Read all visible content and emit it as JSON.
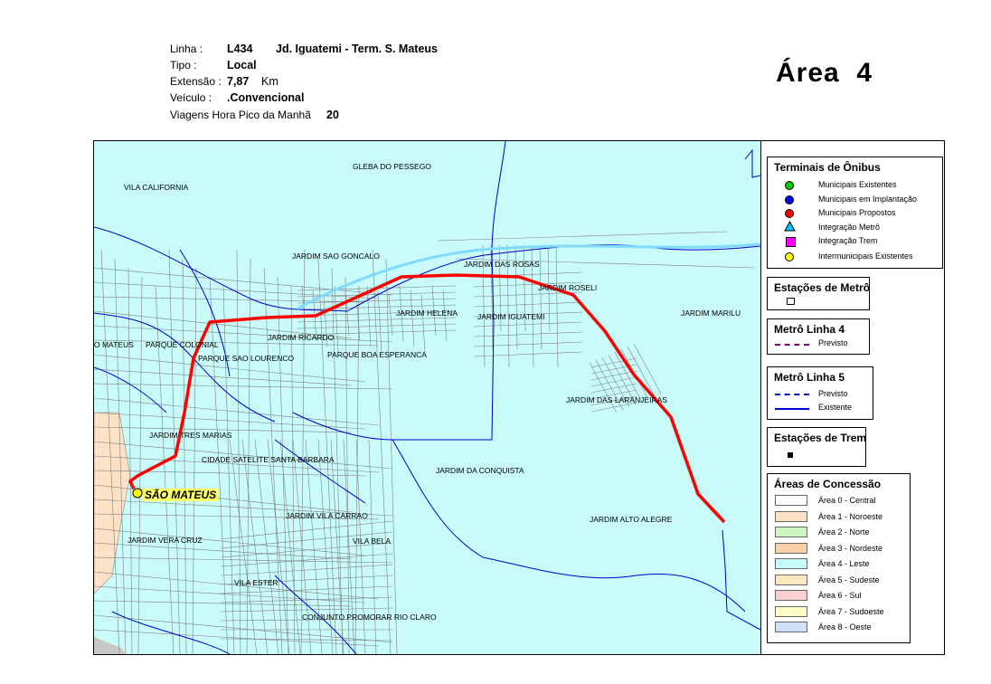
{
  "header": {
    "linha_label": "Linha :",
    "linha_code": "L434",
    "linha_name": "Jd. Iguatemi - Term. S. Mateus",
    "tipo_label": "Tipo :",
    "tipo_value": "Local",
    "extensao_label": "Extensão :",
    "extensao_value": "7,87",
    "extensao_unit": "Km",
    "veiculo_label": "Veículo :",
    "veiculo_value": ".Convencional",
    "viagens_label": "Viagens Hora Pico da Manhã",
    "viagens_value": "20",
    "area_title": "Área  4"
  },
  "map": {
    "colors": {
      "background": "#c9fbfb",
      "route": "#ff0000",
      "streets": "#7f7f7f",
      "rivers": "#0000c8",
      "area1_zone": "#fde2c5"
    },
    "terminal_label": "SÃO MATEUS",
    "places": [
      "GLEBA DO PESSEGO",
      "VILA CALIFORNIA",
      "JARDIM SAO GONCALO",
      "JARDIM DAS ROSAS",
      "JARDIM ROSELI",
      "JARDIM HELENA",
      "JARDIM IGUATEMI",
      "JARDIM MARILU",
      "O MATEUS",
      "PARQUE COLONIAL",
      "JARDIM RICARDO",
      "PARQUE SAO LOURENCO",
      "PARQUE BOA ESPERANCA",
      "JARDIM DAS LARANJEIRAS",
      "JARDIM TRES MARIAS",
      "CIDADE SATELITE SANTA BARBARA",
      "JARDIM DA CONQUISTA",
      "JARDIM VILA CARRAO",
      "JARDIM ALTO ALEGRE",
      "JARDIM VERA CRUZ",
      "VILA BELA",
      "VILA ESTER",
      "CONJUNTO PROMORAR RIO CLARO"
    ]
  },
  "legend": {
    "terminais": {
      "title": "Terminais de Ônibus",
      "items": [
        {
          "label": "Municipais Existentes",
          "color": "#00cc00",
          "shape": "circle"
        },
        {
          "label": "Municipais em Implantação",
          "color": "#0000ff",
          "shape": "circle"
        },
        {
          "label": "Municipais Propostos",
          "color": "#ff0000",
          "shape": "circle"
        },
        {
          "label": "Integração Metrô",
          "color": "#00ccff",
          "shape": "triangle"
        },
        {
          "label": "Integração Trem",
          "color": "#ff00ff",
          "shape": "square"
        },
        {
          "label": "Intermunicipais Existentes",
          "color": "#ffff00",
          "shape": "circle"
        }
      ]
    },
    "estacoes_metro": {
      "title": "Estações de Metrô"
    },
    "metro_linha4": {
      "title": "Metrô Linha 4",
      "previsto": "Previsto",
      "color": "#800080"
    },
    "metro_linha5": {
      "title": "Metrô Linha 5",
      "previsto": "Previsto",
      "existente": "Existente",
      "color": "#0000cc"
    },
    "estacoes_trem": {
      "title": "Estações de Trem"
    },
    "areas": {
      "title": "Áreas de Concessão",
      "items": [
        {
          "label": "Área 0 - Central",
          "color": "#ffffff"
        },
        {
          "label": "Área 1 - Noroeste",
          "color": "#fde2c5"
        },
        {
          "label": "Área 2 - Norte",
          "color": "#cdf5c0"
        },
        {
          "label": "Área 3 - Nordeste",
          "color": "#fcd0a8"
        },
        {
          "label": "Área 4 - Leste",
          "color": "#c9fbfb"
        },
        {
          "label": "Área 5 - Sudeste",
          "color": "#fde7c0"
        },
        {
          "label": "Área 6 - Sul",
          "color": "#fcd0d0"
        },
        {
          "label": "Área 7 - Sudoeste",
          "color": "#fefdc8"
        },
        {
          "label": "Área 8 - Oeste",
          "color": "#cfe0fb"
        }
      ]
    }
  }
}
